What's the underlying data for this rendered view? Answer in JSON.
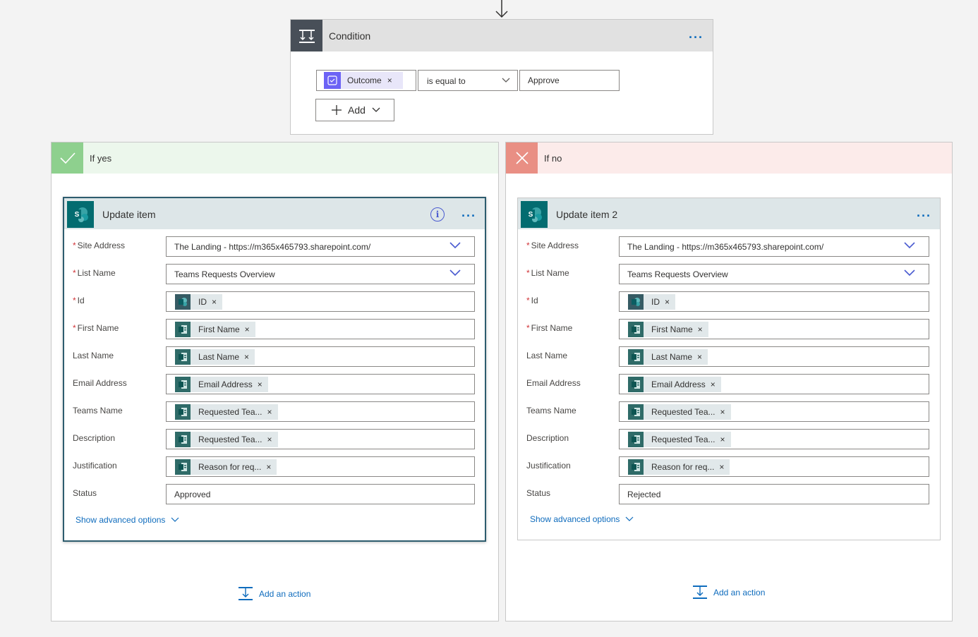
{
  "condition": {
    "title": "Condition",
    "menu_label": "···",
    "row": {
      "left_token": "Outcome",
      "token_remove": "×",
      "operator": "is equal to",
      "right_value": "Approve"
    },
    "add_label": "Add"
  },
  "branches": {
    "yes": {
      "title": "If yes",
      "card": {
        "title": "Update item",
        "menu_label": "···",
        "info_label": "i",
        "fields": [
          {
            "label": "Site Address",
            "required": true,
            "type": "select",
            "value": "The Landing - https://m365x465793.sharepoint.com/"
          },
          {
            "label": "List Name",
            "required": true,
            "type": "select",
            "value": "Teams Requests Overview"
          },
          {
            "label": "Id",
            "required": true,
            "type": "token",
            "token_source": "sharepoint",
            "value": "ID"
          },
          {
            "label": "First Name",
            "required": true,
            "type": "token",
            "token_source": "forms",
            "value": "First Name"
          },
          {
            "label": "Last Name",
            "required": false,
            "type": "token",
            "token_source": "forms",
            "value": "Last Name"
          },
          {
            "label": "Email Address",
            "required": false,
            "type": "token",
            "token_source": "forms",
            "value": "Email Address"
          },
          {
            "label": "Teams Name",
            "required": false,
            "type": "token",
            "token_source": "forms",
            "value": "Requested Tea..."
          },
          {
            "label": "Description",
            "required": false,
            "type": "token",
            "token_source": "forms",
            "value": "Requested Tea..."
          },
          {
            "label": "Justification",
            "required": false,
            "type": "token",
            "token_source": "forms",
            "value": "Reason for req..."
          },
          {
            "label": "Status",
            "required": false,
            "type": "text",
            "value": "Approved"
          }
        ],
        "advanced_label": "Show advanced options"
      },
      "add_action_label": "Add an action"
    },
    "no": {
      "title": "If no",
      "card": {
        "title": "Update item 2",
        "menu_label": "···",
        "fields": [
          {
            "label": "Site Address",
            "required": true,
            "type": "select",
            "value": "The Landing - https://m365x465793.sharepoint.com/"
          },
          {
            "label": "List Name",
            "required": true,
            "type": "select",
            "value": "Teams Requests Overview"
          },
          {
            "label": "Id",
            "required": true,
            "type": "token",
            "token_source": "sharepoint",
            "value": "ID"
          },
          {
            "label": "First Name",
            "required": true,
            "type": "token",
            "token_source": "forms",
            "value": "First Name"
          },
          {
            "label": "Last Name",
            "required": false,
            "type": "token",
            "token_source": "forms",
            "value": "Last Name"
          },
          {
            "label": "Email Address",
            "required": false,
            "type": "token",
            "token_source": "forms",
            "value": "Email Address"
          },
          {
            "label": "Teams Name",
            "required": false,
            "type": "token",
            "token_source": "forms",
            "value": "Requested Tea..."
          },
          {
            "label": "Description",
            "required": false,
            "type": "token",
            "token_source": "forms",
            "value": "Requested Tea..."
          },
          {
            "label": "Justification",
            "required": false,
            "type": "token",
            "token_source": "forms",
            "value": "Reason for req..."
          },
          {
            "label": "Status",
            "required": false,
            "type": "text",
            "value": "Rejected"
          }
        ],
        "advanced_label": "Show advanced options"
      },
      "add_action_label": "Add an action"
    }
  },
  "colors": {
    "accent": "#0f6cbd",
    "yes_header": "#ecf7ec",
    "yes_icon": "#8ed08e",
    "no_header": "#fcebea",
    "no_icon": "#e98f84",
    "sharepoint": "#036c70",
    "approvals": "#6c63f5"
  }
}
